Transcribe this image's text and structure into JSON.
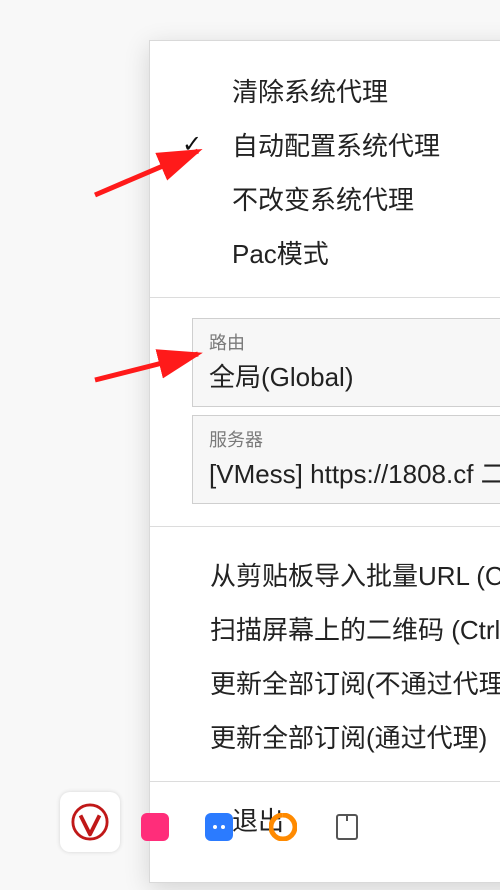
{
  "menu": {
    "proxyModes": {
      "clear": "清除系统代理",
      "auto": "自动配置系统代理",
      "keep": "不改变系统代理",
      "pac": "Pac模式",
      "selected": "auto"
    },
    "route": {
      "label": "路由",
      "value": "全局(Global)"
    },
    "server": {
      "label": "服务器",
      "value": "[VMess] https://1808.cf 二"
    },
    "actions": {
      "importClipboard": "从剪贴板导入批量URL (Ctrl",
      "scanQR": "扫描屏幕上的二维码 (Ctrl+S",
      "updateSubsNoProxy": "更新全部订阅(不通过代理)",
      "updateSubsProxy": "更新全部订阅(通过代理)"
    },
    "exit": "退出"
  },
  "tray": {
    "mainIcon": "v2ray-icon",
    "items": [
      "pink-app-icon",
      "chat-icon",
      "orange-app-icon",
      "page-icon"
    ]
  }
}
